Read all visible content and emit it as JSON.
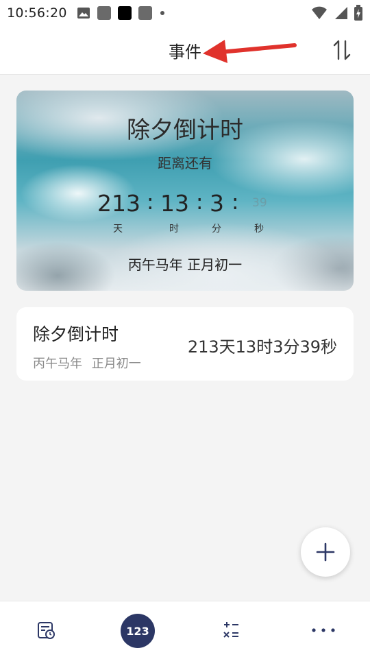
{
  "status_bar": {
    "time": "10:56:20",
    "left_icons": [
      "image-icon",
      "app-square-icon",
      "app-square-icon",
      "app-square-icon",
      "dot-icon"
    ],
    "right_icons": [
      "wifi-icon",
      "signal-icon",
      "battery-charging-icon"
    ]
  },
  "app_bar": {
    "title": "事件",
    "sort_icon": "sort-icon"
  },
  "banner": {
    "title": "除夕倒计时",
    "subtitle": "距离还有",
    "countdown": {
      "days": "213",
      "hours": "13",
      "minutes": "3",
      "seconds": "39",
      "colon": ":",
      "unit_days": "天",
      "unit_hours": "时",
      "unit_minutes": "分",
      "unit_seconds": "秒"
    },
    "lunar_date": "丙午马年 正月初一"
  },
  "events": [
    {
      "title": "除夕倒计时",
      "lunar_date": "丙午马年 正月初一",
      "countdown": "213天13时3分39秒"
    }
  ],
  "fab": {
    "icon": "plus-icon"
  },
  "bottom_nav": {
    "items": [
      {
        "icon": "calendar-clock-icon"
      },
      {
        "icon": "counter-icon",
        "label": "123",
        "active": true
      },
      {
        "icon": "calculator-icon"
      },
      {
        "icon": "more-icon"
      }
    ]
  },
  "colors": {
    "accent": "#2c3765",
    "background": "#f4f4f4",
    "annotation_arrow": "#e0322c"
  }
}
